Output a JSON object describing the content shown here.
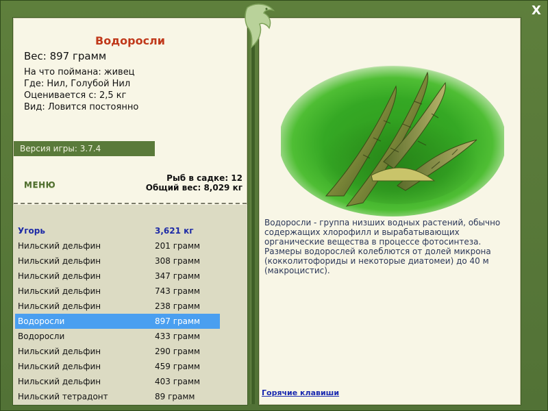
{
  "fish": {
    "name": "Водоросли",
    "weight_line": "Вес: 897 грамм",
    "caught_on": "На что поймана: живец",
    "where": "Где: Нил, Голубой Нил",
    "valued_from": "Оценивается с: 2,5 кг",
    "kind": "Вид: Ловится постоянно",
    "description": "Водоросли - группа низших водных растений, обычно содержащих хлорофилл и вырабатывающих органические вещества в процессе фотосинтеза. Размеры водорослей колеблются от долей микрона (кокколитофориды и некоторые диатомеи) до 40 м (макроцистис)."
  },
  "version": "Версия игры: 3.7.4",
  "menu_label": "МЕНЮ",
  "cage": {
    "count_label": "Рыб в садке: 12",
    "total_label": "Общий вес: 8,029 кг"
  },
  "catch_list": [
    {
      "name": "Угорь",
      "weight": "3,621 кг",
      "header": true
    },
    {
      "name": "Нильский дельфин",
      "weight": "201 грамм"
    },
    {
      "name": "Нильский дельфин",
      "weight": "308 грамм"
    },
    {
      "name": "Нильский дельфин",
      "weight": "347 грамм"
    },
    {
      "name": "Нильский дельфин",
      "weight": "743 грамм"
    },
    {
      "name": "Нильский дельфин",
      "weight": "238 грамм"
    },
    {
      "name": "Водоросли",
      "weight": "897 грамм",
      "selected": true
    },
    {
      "name": "Водоросли",
      "weight": "433 грамм"
    },
    {
      "name": "Нильский дельфин",
      "weight": "290 грамм"
    },
    {
      "name": "Нильский дельфин",
      "weight": "459 грамм"
    },
    {
      "name": "Нильский дельфин",
      "weight": "403 грамм"
    },
    {
      "name": "Нильский тетрадонт",
      "weight": "89 грамм"
    }
  ],
  "hotkeys_label": "Горячие клавиши",
  "close_label": "X",
  "icons": {
    "close": "close-icon",
    "ornament": "dolphin-icon",
    "fish_image": "algae-image"
  },
  "colors": {
    "frame": "#557535",
    "panel": "#f8f6e6",
    "title": "#c0391b",
    "selected_row": "#4a9ff0",
    "list_header": "#1d2aa6",
    "link": "#1a2ab0"
  }
}
